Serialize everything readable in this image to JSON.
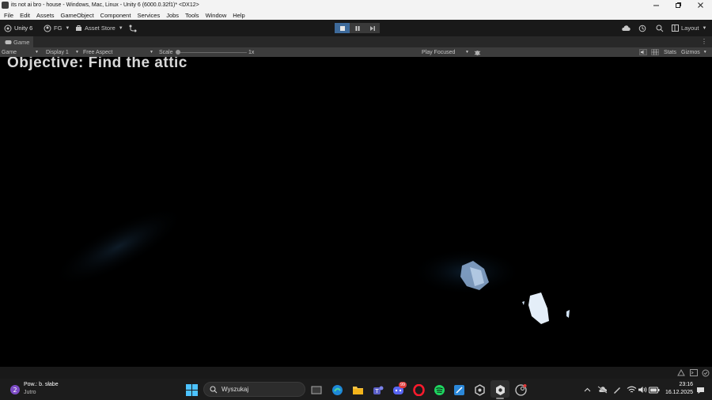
{
  "window": {
    "title": "its not ai bro - house - Windows, Mac, Linux - Unity 6 (6000.0.32f1)* <DX12>"
  },
  "menu": [
    "File",
    "Edit",
    "Assets",
    "GameObject",
    "Component",
    "Services",
    "Jobs",
    "Tools",
    "Window",
    "Help"
  ],
  "toolbar": {
    "unity_label": "Unity 6",
    "account_label": "FG",
    "asset_store_label": "Asset Store",
    "layout_label": "Layout"
  },
  "tab": {
    "label": "Game"
  },
  "game_toolbar": {
    "mode": "Game",
    "display": "Display 1",
    "aspect": "Free Aspect",
    "scale_label": "Scale",
    "scale_value": "1x",
    "scale_fraction": 0.0,
    "play_mode": "Play Focused",
    "stats_label": "Stats",
    "gizmos_label": "Gizmos"
  },
  "game": {
    "objective": "Objective: Find the attic"
  },
  "taskbar": {
    "weather_line1": "Pow.: b. słabe",
    "weather_line2": "Jutro",
    "search_placeholder": "Wyszukaj",
    "discord_badge": "99",
    "time": "23:16",
    "date": "16.12.2025"
  },
  "colors": {
    "play_accent": "#3e6a9a",
    "editor_bg": "#191919",
    "taskbar_bg": "#1c1c1c"
  }
}
